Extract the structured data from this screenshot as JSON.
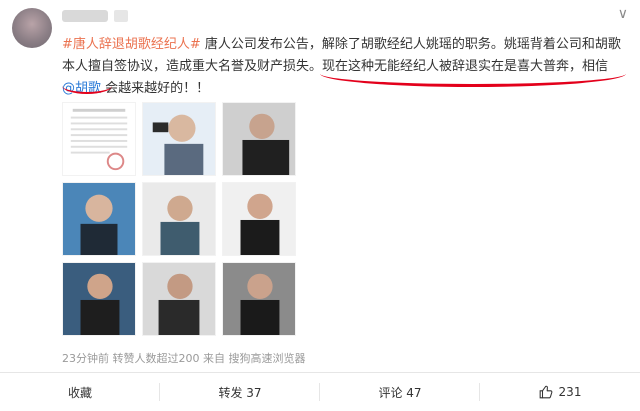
{
  "post": {
    "hashtag": "#唐人辞退胡歌经纪人#",
    "body_part1": " 唐人公司发布公告，解除了胡歌经纪人姚瑶的职务。姚瑶背着公司和胡歌本人擅自签协议，造成重大名誉及财产损失。",
    "body_part2": "现在这种无能经纪人被辞退实在是喜大普奔，相信",
    "mention": "@胡歌",
    "body_part3": " 会越来越好的！！",
    "meta": "23分钟前 转赞人数超过200 来自 搜狗高速浏览器"
  },
  "actions": {
    "collect": "收藏",
    "forward": "转发 37",
    "comment": "评论 47",
    "like_count": "231"
  },
  "ui": {
    "chevron": "∨"
  }
}
